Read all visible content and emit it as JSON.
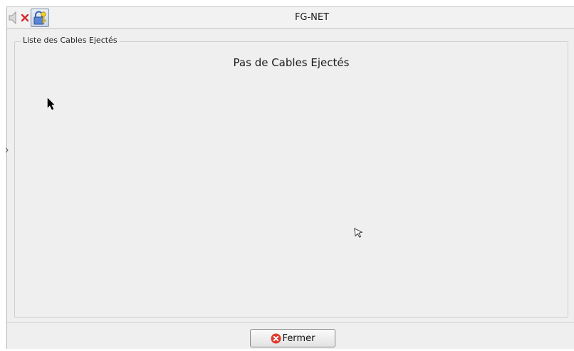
{
  "window": {
    "title": "FG-NET"
  },
  "titlebar": {
    "icons": [
      "speaker-muted-icon",
      "lock-key-icon"
    ]
  },
  "panel": {
    "legend": "Liste des Cables Ejectés",
    "empty_message": "Pas de Cables Ejectés"
  },
  "footer": {
    "close_label": "Fermer",
    "close_icon": "error-x-icon"
  },
  "colors": {
    "background": "#efefef",
    "close_icon_red": "#e03a2e"
  }
}
